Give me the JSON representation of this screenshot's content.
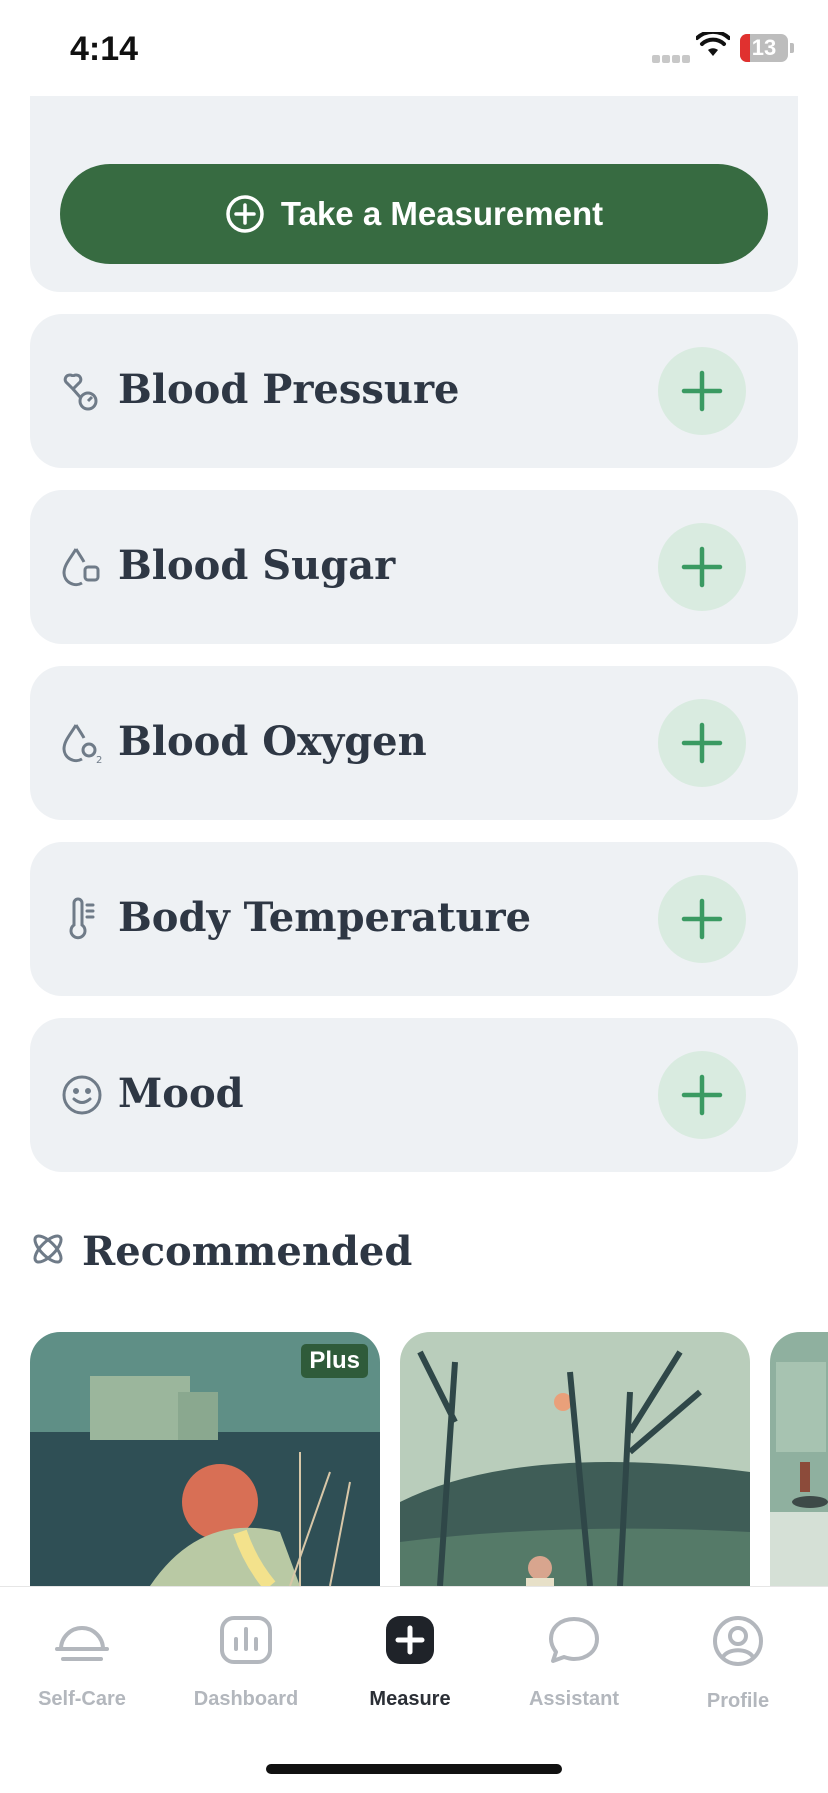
{
  "status_bar": {
    "time": "4:14",
    "battery": "13"
  },
  "take_measurement": {
    "label": "Take a Measurement"
  },
  "measurements": [
    {
      "label": "Blood Pressure",
      "icon": "blood-pressure-icon"
    },
    {
      "label": "Blood Sugar",
      "icon": "blood-sugar-icon"
    },
    {
      "label": "Blood Oxygen",
      "icon": "blood-oxygen-icon"
    },
    {
      "label": "Body Temperature",
      "icon": "thermometer-icon"
    },
    {
      "label": "Mood",
      "icon": "smiley-icon"
    }
  ],
  "recommended": {
    "title": "Recommended",
    "badge": "Plus"
  },
  "tabs": [
    {
      "label": "Self-Care",
      "icon": "bell-dome-icon",
      "active": false
    },
    {
      "label": "Dashboard",
      "icon": "chart-icon",
      "active": false
    },
    {
      "label": "Measure",
      "icon": "plus-square-icon",
      "active": true
    },
    {
      "label": "Assistant",
      "icon": "chat-bubble-icon",
      "active": false
    },
    {
      "label": "Profile",
      "icon": "profile-icon",
      "active": false
    }
  ],
  "colors": {
    "primary_green": "#376b41",
    "add_button_bg": "#d9ebe0",
    "add_plus": "#3a9a62",
    "card_bg": "#eef1f4"
  }
}
